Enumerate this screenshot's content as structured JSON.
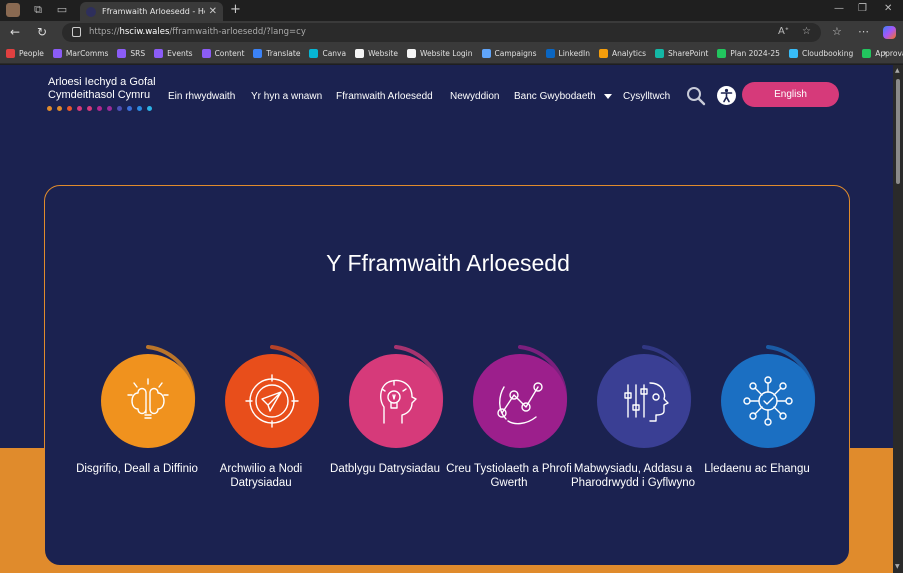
{
  "browser": {
    "tab_title": "Fframwaith Arloesedd - Health and",
    "url_prefix": "https://",
    "url_host": "hsciw.wales",
    "url_path": "/fframwaith-arloesedd/?lang=cy",
    "bookmarks": [
      {
        "label": "People",
        "color": "#e04040"
      },
      {
        "label": "MarComms",
        "color": "#8b5cf6"
      },
      {
        "label": "SRS",
        "color": "#8b5cf6"
      },
      {
        "label": "Events",
        "color": "#8b5cf6"
      },
      {
        "label": "Content",
        "color": "#8b5cf6"
      },
      {
        "label": "Translate",
        "color": "#3b82f6"
      },
      {
        "label": "Canva",
        "color": "#06b6d4"
      },
      {
        "label": "Website",
        "color": "#f5f5f5"
      },
      {
        "label": "Website Login",
        "color": "#f5f5f5"
      },
      {
        "label": "Campaigns",
        "color": "#60a5fa"
      },
      {
        "label": "LinkedIn",
        "color": "#0a66c2"
      },
      {
        "label": "Analytics",
        "color": "#f59e0b"
      },
      {
        "label": "SharePoint",
        "color": "#14b8a6"
      },
      {
        "label": "Plan 2024-25",
        "color": "#22c55e"
      },
      {
        "label": "Cloudbooking",
        "color": "#38bdf8"
      },
      {
        "label": "ApprovalMax",
        "color": "#22c55e"
      }
    ]
  },
  "site": {
    "logo_line1": "Arloesi Iechyd a Gofal",
    "logo_line2": "Cymdeithasol Cymru",
    "logo_dot_colors": [
      "#e08b2c",
      "#e08b2c",
      "#e8572a",
      "#d63a7a",
      "#d63a7a",
      "#b0278f",
      "#9a2b9a",
      "#4b4fb5",
      "#3b6fd8",
      "#2b8ae0",
      "#2bb3e6"
    ],
    "nav": [
      "Ein rhwydwaith",
      "Yr hyn a wnawn",
      "Fframwaith Arloesedd",
      "Newyddion",
      "Banc Gwybodaeth",
      "Cysylltwch"
    ],
    "lang_button": "English",
    "heading": "Y Fframwaith Arloesedd",
    "stages": [
      {
        "label": "Disgrifio, Deall a Diffinio",
        "color": "#f0921e",
        "icon": "brain-lightbulb-icon"
      },
      {
        "label": "Archwilio a Nodi Datrysiadau",
        "color": "#e84e1b",
        "icon": "compass-icon"
      },
      {
        "label": "Datblygu Datrysiadau",
        "color": "#d63a7a",
        "icon": "head-idea-icon"
      },
      {
        "label": "Creu Tystiolaeth a Phrofi Gwerth",
        "color": "#9c1f8c",
        "icon": "line-graph-icon"
      },
      {
        "label": "Mabwysiadu, Addasu a Pharodrwydd i Gyflwyno",
        "color": "#3a3f94",
        "icon": "sliders-head-icon"
      },
      {
        "label": "Lledaenu ac Ehangu",
        "color": "#1b6fc2",
        "icon": "network-check-icon"
      }
    ]
  }
}
